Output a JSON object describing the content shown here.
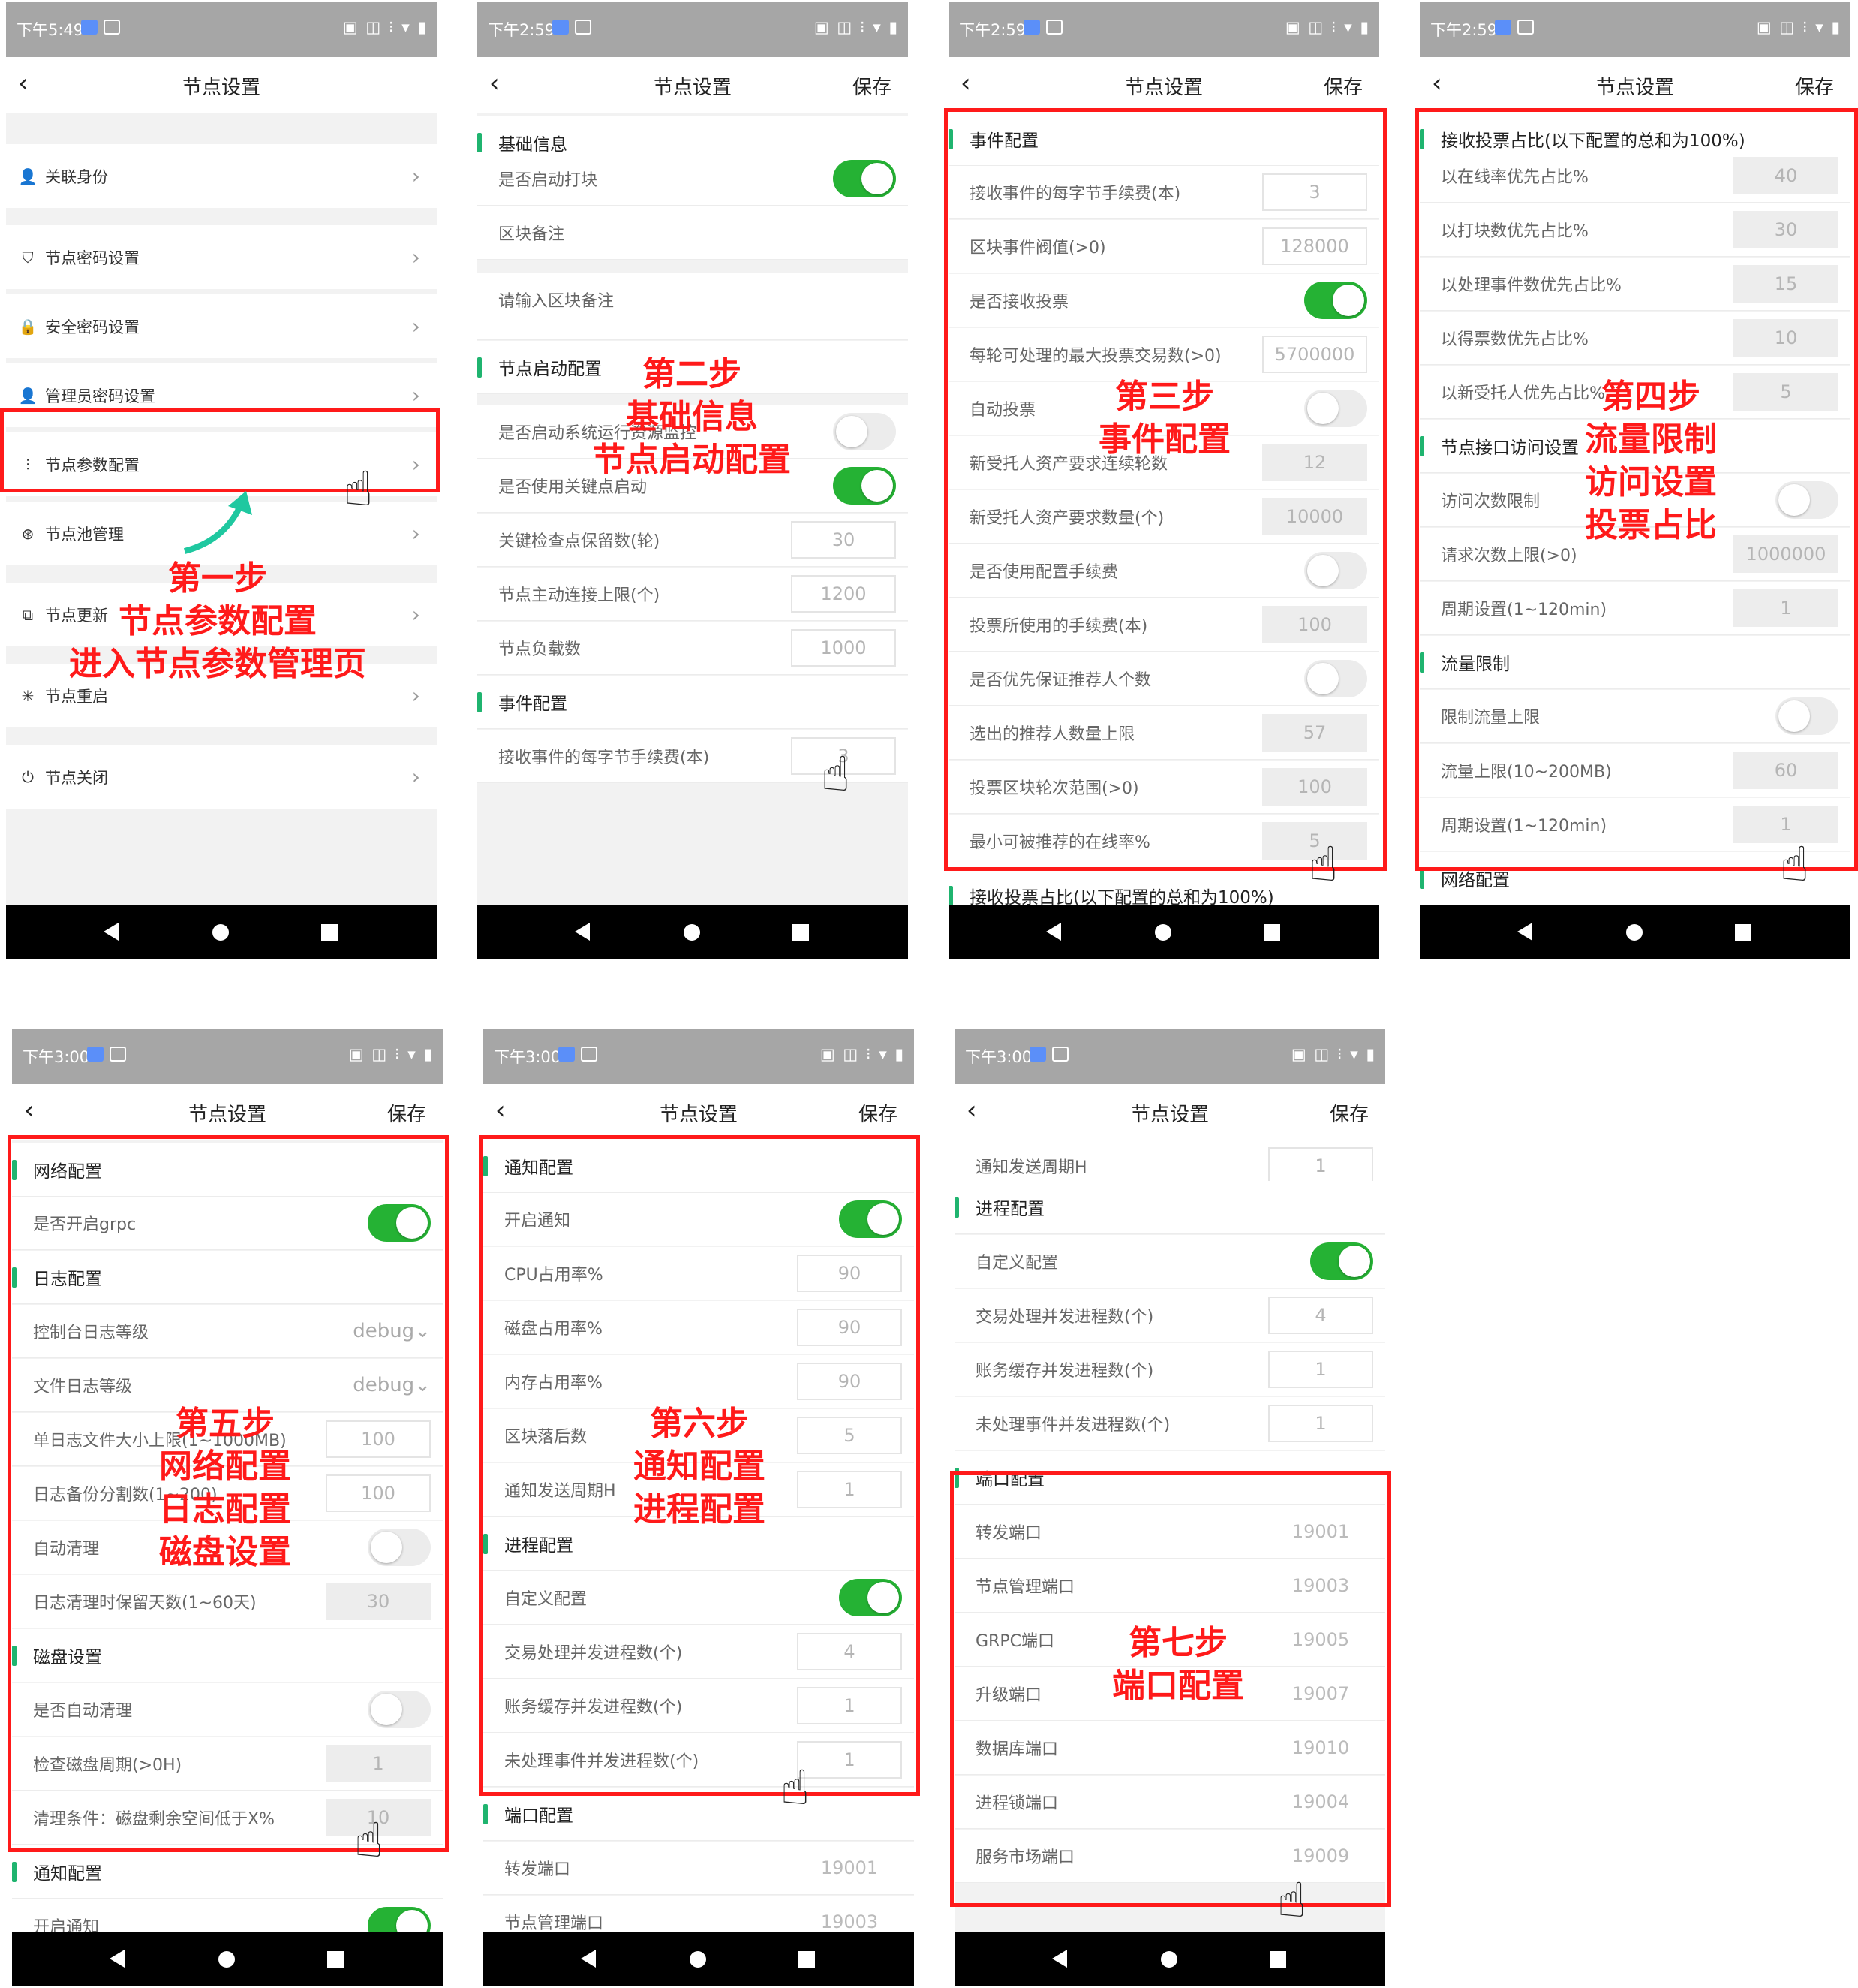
{
  "common": {
    "title": "节点设置",
    "save": "保存",
    "back_glyph": "‹",
    "status_icons": "▣ ◫ ⁝ ▾ ▮",
    "hand_glyph": "☝",
    "chevron": "›"
  },
  "phones": [
    {
      "time": "下午5:49",
      "menu": [
        {
          "icon": "user-icon",
          "glyph": "👤",
          "label": "关联身份"
        },
        {
          "icon": "shield-icon",
          "glyph": "⛉",
          "label": "节点密码设置"
        },
        {
          "icon": "lock-icon",
          "glyph": "🔒",
          "label": "安全密码设置"
        },
        {
          "icon": "admin-icon",
          "glyph": "👤",
          "label": "管理员密码设置"
        },
        {
          "icon": "sliders-icon",
          "glyph": "⫶",
          "label": "节点参数配置"
        },
        {
          "icon": "pool-icon",
          "glyph": "⊛",
          "label": "节点池管理"
        },
        {
          "icon": "update-icon",
          "glyph": "⧉",
          "label": "节点更新"
        },
        {
          "icon": "restart-icon",
          "glyph": "✳",
          "label": "节点重启"
        },
        {
          "icon": "power-icon",
          "glyph": "⏻",
          "label": "节点关闭"
        }
      ],
      "annotation": [
        "第一步",
        "节点参数配置",
        "进入节点参数管理页"
      ]
    },
    {
      "time": "下午2:59",
      "rows": [
        {
          "t": "sec",
          "label": "基础信息"
        },
        {
          "t": "tog",
          "label": "是否启动打块",
          "on": true
        },
        {
          "t": "txt",
          "label": "区块备注"
        },
        {
          "t": "area",
          "label": "请输入区块备注"
        },
        {
          "t": "sec",
          "label": "节点启动配置"
        },
        {
          "t": "tog",
          "label": "是否启动系统运行资源监控",
          "on": false
        },
        {
          "t": "tog",
          "label": "是否使用关键点启动",
          "on": true
        },
        {
          "t": "in",
          "label": "关键检查点保留数(轮)",
          "value": "30"
        },
        {
          "t": "in",
          "label": "节点主动连接上限(个)",
          "value": "1200"
        },
        {
          "t": "in",
          "label": "节点负载数",
          "value": "1000"
        },
        {
          "t": "sec",
          "label": "事件配置"
        },
        {
          "t": "in",
          "label": "接收事件的每字节手续费(本)",
          "value": "3"
        }
      ],
      "annotation": [
        "第二步",
        "基础信息",
        "节点启动配置"
      ]
    },
    {
      "time": "下午2:59",
      "rows": [
        {
          "t": "sec",
          "label": "事件配置"
        },
        {
          "t": "in",
          "label": "接收事件的每字节手续费(本)",
          "value": "3"
        },
        {
          "t": "in",
          "label": "区块事件阀值(>0)",
          "value": "128000"
        },
        {
          "t": "tog",
          "label": "是否接收投票",
          "on": true
        },
        {
          "t": "in",
          "label": "每轮可处理的最大投票交易数(>0)",
          "value": "5700000"
        },
        {
          "t": "tog",
          "label": "自动投票",
          "on": false
        },
        {
          "t": "dis",
          "label": "新受托人资产要求连续轮数",
          "value": "12"
        },
        {
          "t": "dis",
          "label": "新受托人资产要求数量(个)",
          "value": "10000"
        },
        {
          "t": "tog",
          "label": "是否使用配置手续费",
          "on": false
        },
        {
          "t": "dis",
          "label": "投票所使用的手续费(本)",
          "value": "100"
        },
        {
          "t": "tog",
          "label": "是否优先保证推荐人个数",
          "on": false
        },
        {
          "t": "dis",
          "label": "选出的推荐人数量上限",
          "value": "57"
        },
        {
          "t": "dis",
          "label": "投票区块轮次范围(>0)",
          "value": "100"
        },
        {
          "t": "dis",
          "label": "最小可被推荐的在线率%",
          "value": "5"
        },
        {
          "t": "sec",
          "label": "接收投票占比(以下配置的总和为100%)"
        }
      ],
      "annotation": [
        "第三步",
        "事件配置"
      ]
    },
    {
      "time": "下午2:59",
      "rows": [
        {
          "t": "sec",
          "label": "接收投票占比(以下配置的总和为100%)"
        },
        {
          "t": "dis",
          "label": "以在线率优先占比%",
          "value": "40"
        },
        {
          "t": "dis",
          "label": "以打块数优先占比%",
          "value": "30"
        },
        {
          "t": "dis",
          "label": "以处理事件数优先占比%",
          "value": "15"
        },
        {
          "t": "dis",
          "label": "以得票数优先占比%",
          "value": "10"
        },
        {
          "t": "dis",
          "label": "以新受托人优先占比%",
          "value": "5"
        },
        {
          "t": "sec",
          "label": "节点接口访问设置"
        },
        {
          "t": "tog",
          "label": "访问次数限制",
          "on": false
        },
        {
          "t": "dis",
          "label": "请求次数上限(>0)",
          "value": "1000000"
        },
        {
          "t": "dis",
          "label": "周期设置(1~120min)",
          "value": "1"
        },
        {
          "t": "sec",
          "label": "流量限制"
        },
        {
          "t": "tog",
          "label": "限制流量上限",
          "on": false
        },
        {
          "t": "dis",
          "label": "流量上限(10~200MB)",
          "value": "60"
        },
        {
          "t": "dis",
          "label": "周期设置(1~120min)",
          "value": "1"
        },
        {
          "t": "sec",
          "label": "网络配置"
        }
      ],
      "annotation": [
        "第四步",
        "流量限制",
        "访问设置",
        "投票占比"
      ]
    },
    {
      "time": "下午3:00",
      "rows": [
        {
          "t": "sec",
          "label": "网络配置"
        },
        {
          "t": "tog",
          "label": "是否开启grpc",
          "on": true
        },
        {
          "t": "sec",
          "label": "日志配置"
        },
        {
          "t": "sel",
          "label": "控制台日志等级",
          "value": "debug"
        },
        {
          "t": "sel",
          "label": "文件日志等级",
          "value": "debug"
        },
        {
          "t": "in",
          "label": "单日志文件大小上限(1~1000MB)",
          "value": "100"
        },
        {
          "t": "in",
          "label": "日志备份分割数(1~200)",
          "value": "100"
        },
        {
          "t": "tog",
          "label": "自动清理",
          "on": false
        },
        {
          "t": "dis",
          "label": "日志清理时保留天数(1~60天)",
          "value": "30"
        },
        {
          "t": "sec",
          "label": "磁盘设置"
        },
        {
          "t": "tog",
          "label": "是否自动清理",
          "on": false
        },
        {
          "t": "dis",
          "label": "检查磁盘周期(>0H)",
          "value": "1"
        },
        {
          "t": "dis",
          "label": "清理条件：磁盘剩余空间低于X%",
          "value": "10"
        },
        {
          "t": "sec",
          "label": "通知配置"
        },
        {
          "t": "tog",
          "label": "开启通知",
          "on": true
        }
      ],
      "annotation": [
        "第五步",
        "网络配置",
        "日志配置",
        "磁盘设置"
      ]
    },
    {
      "time": "下午3:00",
      "rows": [
        {
          "t": "sec",
          "label": "通知配置"
        },
        {
          "t": "tog",
          "label": "开启通知",
          "on": true
        },
        {
          "t": "in",
          "label": "CPU占用率%",
          "value": "90"
        },
        {
          "t": "in",
          "label": "磁盘占用率%",
          "value": "90"
        },
        {
          "t": "in",
          "label": "内存占用率%",
          "value": "90"
        },
        {
          "t": "in",
          "label": "区块落后数",
          "value": "5"
        },
        {
          "t": "in",
          "label": "通知发送周期H",
          "value": "1"
        },
        {
          "t": "sec",
          "label": "进程配置"
        },
        {
          "t": "tog",
          "label": "自定义配置",
          "on": true
        },
        {
          "t": "in",
          "label": "交易处理并发进程数(个)",
          "value": "4"
        },
        {
          "t": "in",
          "label": "账务缓存并发进程数(个)",
          "value": "1"
        },
        {
          "t": "in",
          "label": "未处理事件并发进程数(个)",
          "value": "1"
        },
        {
          "t": "sec",
          "label": "端口配置"
        },
        {
          "t": "plain",
          "label": "转发端口",
          "value": "19001"
        },
        {
          "t": "plain",
          "label": "节点管理端口",
          "value": "19003"
        }
      ],
      "annotation": [
        "第六步",
        "通知配置",
        "进程配置"
      ]
    },
    {
      "time": "下午3:00",
      "rows": [
        {
          "t": "in",
          "label": "通知发送周期H",
          "value": "1"
        },
        {
          "t": "sec",
          "label": "进程配置"
        },
        {
          "t": "tog",
          "label": "自定义配置",
          "on": true
        },
        {
          "t": "in",
          "label": "交易处理并发进程数(个)",
          "value": "4"
        },
        {
          "t": "in",
          "label": "账务缓存并发进程数(个)",
          "value": "1"
        },
        {
          "t": "in",
          "label": "未处理事件并发进程数(个)",
          "value": "1"
        },
        {
          "t": "sec",
          "label": "端口配置"
        },
        {
          "t": "plain",
          "label": "转发端口",
          "value": "19001"
        },
        {
          "t": "plain",
          "label": "节点管理端口",
          "value": "19003"
        },
        {
          "t": "plain",
          "label": "GRPC端口",
          "value": "19005"
        },
        {
          "t": "plain",
          "label": "升级端口",
          "value": "19007"
        },
        {
          "t": "plain",
          "label": "数据库端口",
          "value": "19010"
        },
        {
          "t": "plain",
          "label": "进程锁端口",
          "value": "19004"
        },
        {
          "t": "plain",
          "label": "服务市场端口",
          "value": "19009"
        }
      ],
      "annotation": [
        "第七步",
        "端口配置"
      ]
    }
  ]
}
